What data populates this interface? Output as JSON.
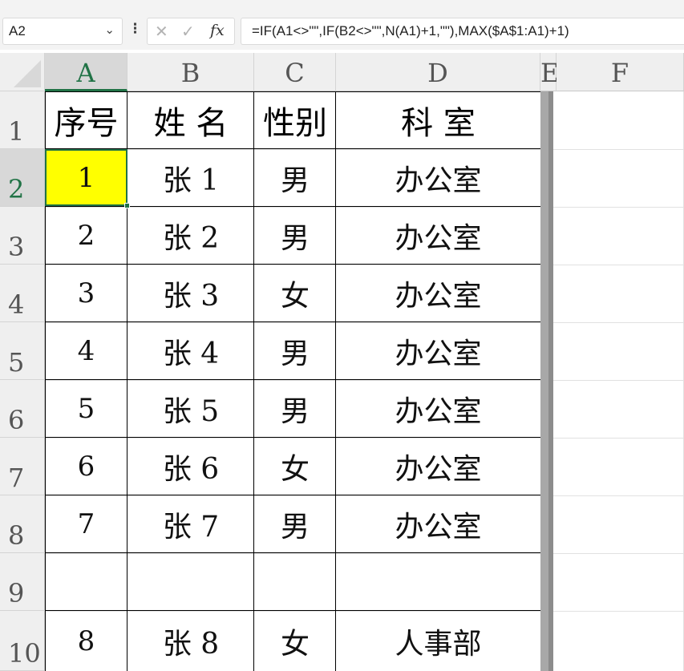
{
  "formula_bar": {
    "name_box": "A2",
    "name_box_icon": "chevron-down-icon",
    "more_icon": "vertical-dots-icon",
    "cancel_icon": "close-icon",
    "confirm_icon": "check-icon",
    "fx_label": "fx",
    "formula": "=IF(A1<>\"\",IF(B2<>\"\",N(A1)+1,\"\"),MAX($A$1:A1)+1)"
  },
  "columns": [
    "A",
    "B",
    "C",
    "D",
    "E",
    "F"
  ],
  "selected_column": "A",
  "rows": [
    "1",
    "2",
    "3",
    "4",
    "5",
    "6",
    "7",
    "8",
    "9",
    "10"
  ],
  "selected_row": "2",
  "header": {
    "c1": "序号",
    "c2": "姓 名",
    "c3": "性别",
    "c4": "科 室"
  },
  "data_rows": [
    {
      "seq": "1",
      "name": "张 1",
      "gender": "男",
      "dept": "办公室"
    },
    {
      "seq": "2",
      "name": "张 2",
      "gender": "男",
      "dept": "办公室"
    },
    {
      "seq": "3",
      "name": "张 3",
      "gender": "女",
      "dept": "办公室"
    },
    {
      "seq": "4",
      "name": "张 4",
      "gender": "男",
      "dept": "办公室"
    },
    {
      "seq": "5",
      "name": "张 5",
      "gender": "男",
      "dept": "办公室"
    },
    {
      "seq": "6",
      "name": "张 6",
      "gender": "女",
      "dept": "办公室"
    },
    {
      "seq": "7",
      "name": "张 7",
      "gender": "男",
      "dept": "办公室"
    },
    {
      "seq": "",
      "name": "",
      "gender": "",
      "dept": ""
    },
    {
      "seq": "8",
      "name": "张 8",
      "gender": "女",
      "dept": "人事部"
    }
  ],
  "colors": {
    "selected_fill": "#ffff00",
    "accent": "#217346"
  }
}
